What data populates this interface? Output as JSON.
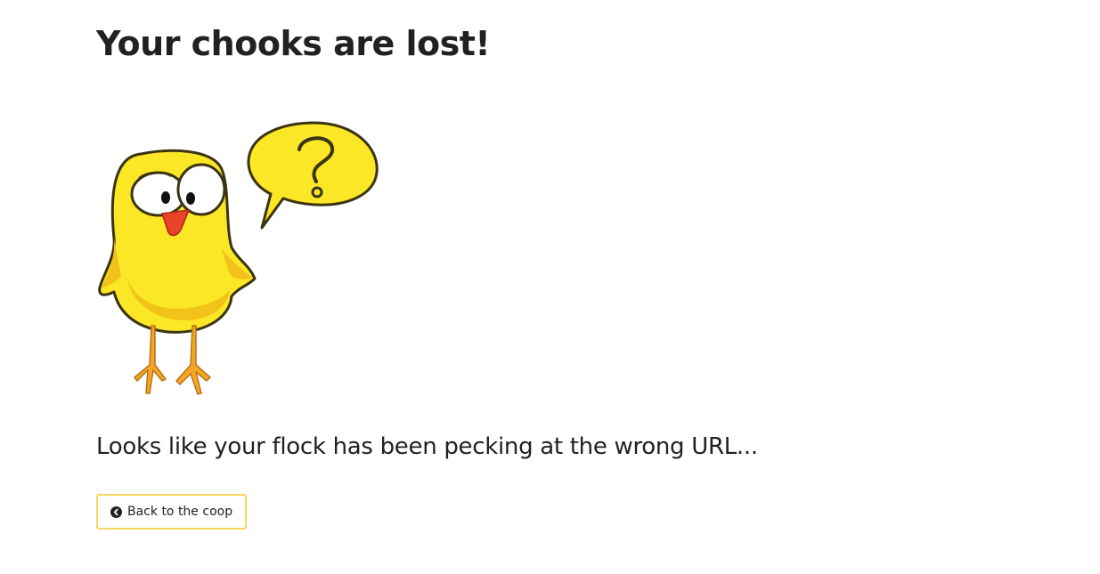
{
  "page": {
    "title": "Your chooks are lost!",
    "message": "Looks like your flock has been pecking at the wrong URL...",
    "back_button": {
      "label": "Back to the coop",
      "icon": "chevron-circle-left-icon"
    }
  },
  "illustration": {
    "subject": "confused-chick-with-question-bubble",
    "colors": {
      "body": "#fbe726",
      "body_shade": "#f2c21b",
      "beak": "#e9442a",
      "legs": "#f5a623",
      "outline": "#3b3410"
    }
  },
  "theme": {
    "button_border": "#f9d65b",
    "text": "#212121",
    "background": "#ffffff"
  }
}
